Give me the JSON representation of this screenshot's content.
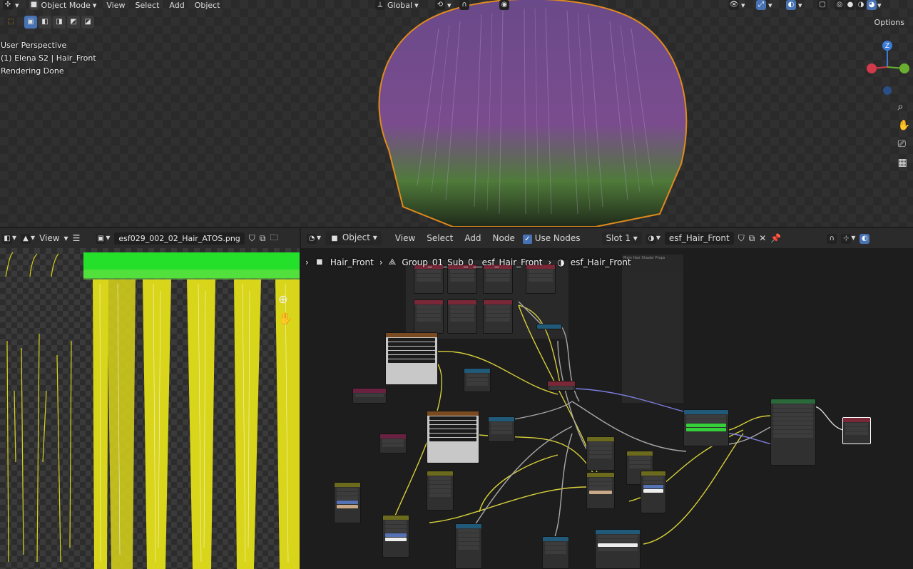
{
  "viewport": {
    "mode_label": "Object Mode",
    "menu": [
      "View",
      "Select",
      "Add",
      "Object"
    ],
    "transform_orientation": "Global",
    "options_label": "Options",
    "overlay_lines": [
      "User Perspective",
      "(1) Elena S2 | Hair_Front",
      "Rendering Done"
    ],
    "gizmo_axis": "Z"
  },
  "image_editor": {
    "view_menu": "View",
    "image_name": "esf029_002_02_Hair_ATOS.png"
  },
  "node_editor": {
    "object_menu": "Object",
    "menu": [
      "View",
      "Select",
      "Add",
      "Node"
    ],
    "use_nodes_label": "Use Nodes",
    "slot_label": "Slot 1",
    "material_name": "esf_Hair_Front",
    "breadcrumb": [
      "Hair_Front",
      "Group_01_Sub_0__esf_Hair_Front",
      "esf_Hair_Front"
    ],
    "frame_label": "Main Hair Shader Props",
    "colors": {
      "header_bg": "#2b2b2b",
      "accent": "#4772b3",
      "link_yellow": "#d6cf3a",
      "link_grey": "#a8a8a8",
      "link_purple": "#7d7de0"
    }
  }
}
